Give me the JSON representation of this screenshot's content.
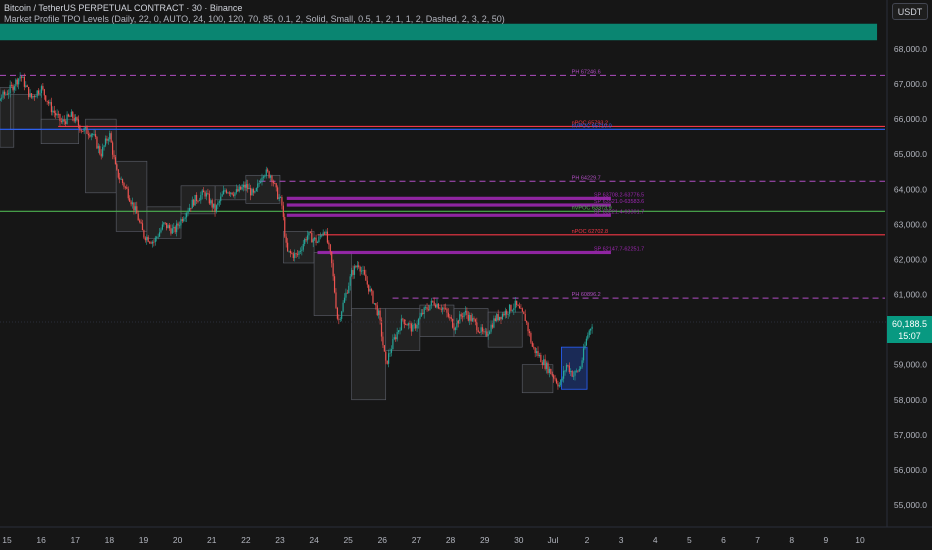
{
  "header": {
    "title": "Bitcoin / TetherUS PERPETUAL CONTRACT · 30 · Binance",
    "indicator": "Market Profile TPO Levels (Daily, 22, 0, AUTO, 24, 100, 120, 70, 85, 0.1, 2, Solid, Small, 0.5, 1, 2, 1, 1, 2, Dashed, 2, 3, 2, 50)",
    "currency": "USDT"
  },
  "price_tag": {
    "price": "60,188.5",
    "countdown": "15:07"
  },
  "colors": {
    "background": "#161616",
    "up": "#26a69a",
    "down": "#ef5350",
    "ph_line": "#b04ec2",
    "poc_red": "#f23645",
    "poc_blue": "#2962ff",
    "single_print": "#9c27b0",
    "teal_zone": "#089981",
    "green_line": "#4caf50"
  },
  "chart_data": {
    "type": "candlestick",
    "title": "Bitcoin / TetherUS PERPETUAL CONTRACT · 30 · Binance",
    "ylim": [
      54500,
      69200
    ],
    "yticks": [
      55000,
      56000,
      57000,
      58000,
      59000,
      60000,
      61000,
      62000,
      63000,
      64000,
      65000,
      66000,
      67000,
      68000
    ],
    "ytick_labels": [
      "55,000.0",
      "56,000.0",
      "57,000.0",
      "58,000.0",
      "59,000.0",
      "60,000.0",
      "61,000.0",
      "62,000.0",
      "63,000.0",
      "64,000.0",
      "65,000.0",
      "66,000.0",
      "67,000.0",
      "68,000.0"
    ],
    "xticks": [
      {
        "day": 15,
        "label": "15"
      },
      {
        "day": 16,
        "label": "16"
      },
      {
        "day": 17,
        "label": "17"
      },
      {
        "day": 18,
        "label": "18"
      },
      {
        "day": 19,
        "label": "19"
      },
      {
        "day": 20,
        "label": "20"
      },
      {
        "day": 21,
        "label": "21"
      },
      {
        "day": 22,
        "label": "22"
      },
      {
        "day": 23,
        "label": "23"
      },
      {
        "day": 24,
        "label": "24"
      },
      {
        "day": 25,
        "label": "25"
      },
      {
        "day": 26,
        "label": "26"
      },
      {
        "day": 27,
        "label": "27"
      },
      {
        "day": 28,
        "label": "28"
      },
      {
        "day": 29,
        "label": "29"
      },
      {
        "day": 30,
        "label": "30"
      },
      {
        "day": 31,
        "label": "Jul"
      },
      {
        "day": 32,
        "label": "2"
      },
      {
        "day": 33,
        "label": "3"
      },
      {
        "day": 34,
        "label": "4"
      },
      {
        "day": 35,
        "label": "5"
      },
      {
        "day": 36,
        "label": "6"
      },
      {
        "day": 37,
        "label": "7"
      },
      {
        "day": 38,
        "label": "8"
      },
      {
        "day": 39,
        "label": "9"
      },
      {
        "day": 40,
        "label": "10"
      }
    ],
    "last_price": 60188.5,
    "price_path": [
      {
        "day": 14.05,
        "price": 63900
      },
      {
        "day": 14.3,
        "price": 64700
      },
      {
        "day": 14.55,
        "price": 65900
      },
      {
        "day": 14.8,
        "price": 66600
      },
      {
        "day": 15.05,
        "price": 66800
      },
      {
        "day": 15.4,
        "price": 67246
      },
      {
        "day": 15.7,
        "price": 66600
      },
      {
        "day": 16.0,
        "price": 66900
      },
      {
        "day": 16.3,
        "price": 66300
      },
      {
        "day": 16.6,
        "price": 65900
      },
      {
        "day": 16.9,
        "price": 66100
      },
      {
        "day": 17.2,
        "price": 65700
      },
      {
        "day": 17.5,
        "price": 65600
      },
      {
        "day": 17.75,
        "price": 65000
      },
      {
        "day": 18.0,
        "price": 65600
      },
      {
        "day": 18.2,
        "price": 64500
      },
      {
        "day": 18.5,
        "price": 64000
      },
      {
        "day": 18.8,
        "price": 63300
      },
      {
        "day": 19.0,
        "price": 62700
      },
      {
        "day": 19.3,
        "price": 62500
      },
      {
        "day": 19.6,
        "price": 63000
      },
      {
        "day": 19.9,
        "price": 62800
      },
      {
        "day": 20.2,
        "price": 63300
      },
      {
        "day": 20.5,
        "price": 63700
      },
      {
        "day": 20.8,
        "price": 63900
      },
      {
        "day": 21.1,
        "price": 63400
      },
      {
        "day": 21.4,
        "price": 64000
      },
      {
        "day": 21.7,
        "price": 63900
      },
      {
        "day": 22.0,
        "price": 64100
      },
      {
        "day": 22.25,
        "price": 63800
      },
      {
        "day": 22.5,
        "price": 64500
      },
      {
        "day": 22.75,
        "price": 64400
      },
      {
        "day": 22.9,
        "price": 63900
      },
      {
        "day": 23.05,
        "price": 63600
      },
      {
        "day": 23.2,
        "price": 62200
      },
      {
        "day": 23.5,
        "price": 62100
      },
      {
        "day": 23.8,
        "price": 62700
      },
      {
        "day": 24.1,
        "price": 62500
      },
      {
        "day": 24.3,
        "price": 62900
      },
      {
        "day": 24.5,
        "price": 62000
      },
      {
        "day": 24.7,
        "price": 60200
      },
      {
        "day": 24.9,
        "price": 60900
      },
      {
        "day": 25.1,
        "price": 61600
      },
      {
        "day": 25.3,
        "price": 61900
      },
      {
        "day": 25.6,
        "price": 61200
      },
      {
        "day": 25.9,
        "price": 60400
      },
      {
        "day": 26.1,
        "price": 59000
      },
      {
        "day": 26.3,
        "price": 59600
      },
      {
        "day": 26.6,
        "price": 60300
      },
      {
        "day": 26.9,
        "price": 60000
      },
      {
        "day": 27.2,
        "price": 60500
      },
      {
        "day": 27.5,
        "price": 60800
      },
      {
        "day": 27.8,
        "price": 60600
      },
      {
        "day": 28.1,
        "price": 60100
      },
      {
        "day": 28.4,
        "price": 60500
      },
      {
        "day": 28.7,
        "price": 60200
      },
      {
        "day": 29.0,
        "price": 59800
      },
      {
        "day": 29.3,
        "price": 60300
      },
      {
        "day": 29.6,
        "price": 60500
      },
      {
        "day": 29.9,
        "price": 60700
      },
      {
        "day": 30.2,
        "price": 60300
      },
      {
        "day": 30.4,
        "price": 59500
      },
      {
        "day": 30.7,
        "price": 59100
      },
      {
        "day": 31.0,
        "price": 58700
      },
      {
        "day": 31.2,
        "price": 58400
      },
      {
        "day": 31.4,
        "price": 59000
      },
      {
        "day": 31.6,
        "price": 58700
      },
      {
        "day": 31.8,
        "price": 58900
      },
      {
        "day": 32.0,
        "price": 59800
      },
      {
        "day": 32.15,
        "price": 60188.5
      }
    ],
    "tpo_boxes": [
      {
        "day_start": 14.3,
        "day_end": 15.2,
        "low": 65200,
        "high": 66900
      },
      {
        "day_start": 14.0,
        "day_end": 14.2,
        "low": 63700,
        "high": 64500
      },
      {
        "day_start": 15.1,
        "day_end": 16.0,
        "low": 65700,
        "high": 66700
      },
      {
        "day_start": 16.0,
        "day_end": 17.1,
        "low": 65300,
        "high": 66000
      },
      {
        "day_start": 17.3,
        "day_end": 18.2,
        "low": 63900,
        "high": 66000
      },
      {
        "day_start": 18.2,
        "day_end": 19.1,
        "low": 62800,
        "high": 64800
      },
      {
        "day_start": 19.1,
        "day_end": 20.1,
        "low": 62600,
        "high": 63500
      },
      {
        "day_start": 20.1,
        "day_end": 21.1,
        "low": 63300,
        "high": 64100
      },
      {
        "day_start": 21.1,
        "day_end": 22.0,
        "low": 63700,
        "high": 64100
      },
      {
        "day_start": 22.0,
        "day_end": 23.0,
        "low": 63600,
        "high": 64400
      },
      {
        "day_start": 23.1,
        "day_end": 24.0,
        "low": 61900,
        "high": 62800
      },
      {
        "day_start": 24.0,
        "day_end": 25.1,
        "low": 60400,
        "high": 62200
      },
      {
        "day_start": 25.1,
        "day_end": 26.1,
        "low": 58000,
        "high": 60600
      },
      {
        "day_start": 26.1,
        "day_end": 27.1,
        "low": 59400,
        "high": 60600
      },
      {
        "day_start": 27.1,
        "day_end": 28.1,
        "low": 59800,
        "high": 60700
      },
      {
        "day_start": 28.1,
        "day_end": 29.1,
        "low": 59800,
        "high": 60600
      },
      {
        "day_start": 29.1,
        "day_end": 30.1,
        "low": 59500,
        "high": 60500
      },
      {
        "day_start": 30.1,
        "day_end": 31.0,
        "low": 58200,
        "high": 59000
      }
    ],
    "current_box": {
      "day_start": 31.25,
      "day_end": 32.0,
      "low": 58300,
      "high": 59500
    },
    "zones": [
      {
        "kind": "teal-zone",
        "price_low": 68250,
        "price_high": 68720,
        "day_start": 14.0,
        "day_end": 40.5
      }
    ],
    "levels": [
      {
        "kind": "dashed",
        "price": 67246.6,
        "day_start": 14.1,
        "label": "PH 67246.6",
        "color_key": "ph_line"
      },
      {
        "kind": "solid",
        "price": 65793.2,
        "day_start": 16.5,
        "label": "nPOC 65793.2",
        "color_key": "poc_red"
      },
      {
        "kind": "solid",
        "price": 65710.0,
        "day_start": 14.0,
        "label": "nVPOC 65710.0",
        "color_key": "poc_blue"
      },
      {
        "kind": "dashed",
        "price": 64229.7,
        "day_start": 22.4,
        "label": "PH 64229.7",
        "color_key": "ph_line"
      },
      {
        "kind": "band",
        "price": 63742,
        "day_start": 23.2,
        "label": "SP 63708.2-63776.5",
        "color_key": "single_print"
      },
      {
        "kind": "band",
        "price": 63552,
        "day_start": 23.2,
        "label": "SP 63521.0-63583.6",
        "color_key": "single_print"
      },
      {
        "kind": "solid",
        "price": 63373.9,
        "day_start": 14.0,
        "label": "nVPOC 63373.9",
        "color_key": "green_line"
      },
      {
        "kind": "band",
        "price": 63260,
        "day_start": 23.2,
        "label": "SP 63221.4-63301.7",
        "color_key": "single_print"
      },
      {
        "kind": "solid",
        "price": 62702.8,
        "day_start": 24.1,
        "label": "nPOC 62702.8",
        "color_key": "poc_red"
      },
      {
        "kind": "band",
        "price": 62199,
        "day_start": 24.1,
        "label": "SP 62147.7-62251.7",
        "color_key": "single_print"
      },
      {
        "kind": "dashed",
        "price": 60896.2,
        "day_start": 26.3,
        "label": "PH 60896.2",
        "color_key": "ph_line"
      }
    ],
    "grid": false,
    "legend": "none"
  }
}
